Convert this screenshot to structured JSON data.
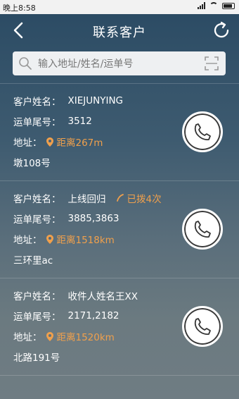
{
  "status_bar": {
    "time": "晚上8:58"
  },
  "header": {
    "title": "联系客户"
  },
  "search": {
    "placeholder": "输入地址/姓名/运单号"
  },
  "labels": {
    "customer_name": "客户姓名：",
    "waybill_tail": "运单尾号：",
    "address": "地址："
  },
  "customers": [
    {
      "name": "XIEJUNYING",
      "called": "",
      "waybill": "3512",
      "distance": "距离267m",
      "address": "墩108号"
    },
    {
      "name": "上线回归",
      "called": "已拨4次",
      "waybill": "3885,3863",
      "distance": "距离1518km",
      "address": "三环里ac"
    },
    {
      "name": "收件人姓名王XX",
      "called": "",
      "waybill": "2171,2182",
      "distance": "距离1520km",
      "address": "北路191号"
    }
  ],
  "colors": {
    "accent": "#f0a04c",
    "text": "#ffffff"
  },
  "icons": [
    "back-icon",
    "refresh-icon",
    "search-icon",
    "scan-icon",
    "location-pin-icon",
    "phone-icon"
  ]
}
